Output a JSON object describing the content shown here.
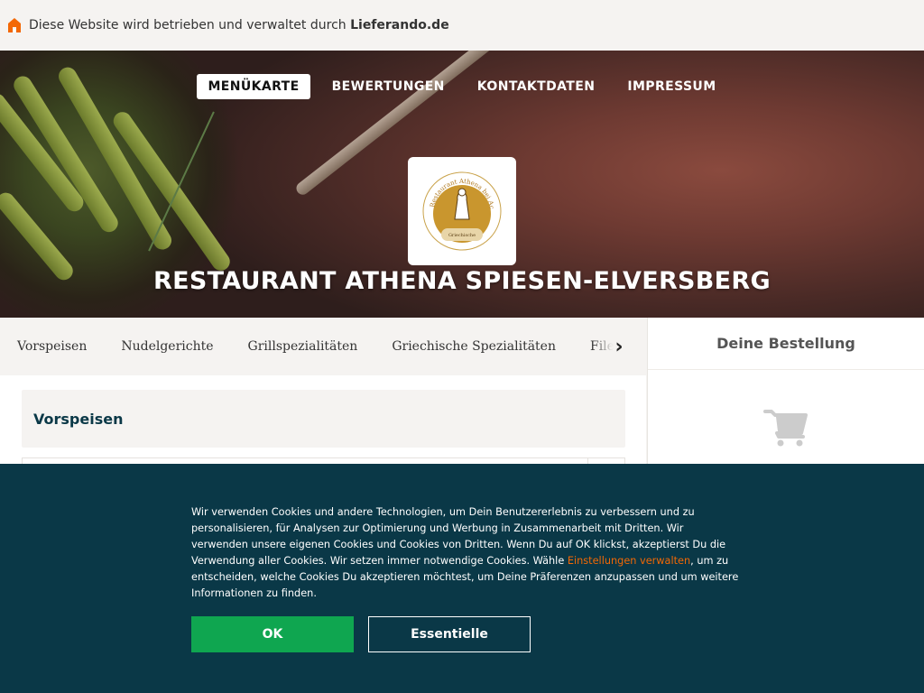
{
  "topbar": {
    "prefix": "Diese Website wird betrieben und verwaltet durch",
    "brand": "Lieferando.de",
    "icon": "house-icon",
    "icon_color": "#f36805"
  },
  "nav": {
    "items": [
      {
        "label": "MENÜKARTE",
        "active": true
      },
      {
        "label": "BEWERTUNGEN",
        "active": false
      },
      {
        "label": "KONTAKTDATEN",
        "active": false
      },
      {
        "label": "IMPRESSUM",
        "active": false
      }
    ]
  },
  "restaurant": {
    "name": "RESTAURANT ATHENA SPIESEN-ELVERSBERG",
    "logo_text": "Restaurant Athena bei Achilles",
    "logo_subtext": "Griechische Spezialitäten"
  },
  "categories": [
    "Vorspeisen",
    "Nudelgerichte",
    "Grillspezialitäten",
    "Griechische Spezialitäten",
    "Filets"
  ],
  "section": {
    "title": "Vorspeisen"
  },
  "basket": {
    "title": "Deine Bestellung",
    "icon": "shopping-cart-icon"
  },
  "cookie": {
    "text_before_link": "Wir verwenden Cookies und andere Technologien, um Dein Benutzererlebnis zu verbessern und zu personalisieren, für Analysen zur Optimierung und Werbung in Zusammenarbeit mit Dritten. Wir verwenden unsere eigenen Cookies und Cookies von Dritten. Wenn Du auf OK klickst, akzeptierst Du die Verwendung aller Cookies. Wir setzen immer notwendige Cookies. Wähle ",
    "link": "Einstellungen verwalten",
    "text_after_link": ", um zu entscheiden, welche Cookies Du akzeptieren möchtest, um Deine Präferenzen anzupassen und um weitere Informationen zu finden.",
    "ok_label": "OK",
    "essential_label": "Essentielle"
  },
  "colors": {
    "accent": "#f36805",
    "banner_bg": "#0a3847",
    "ok_button": "#0fa650"
  }
}
